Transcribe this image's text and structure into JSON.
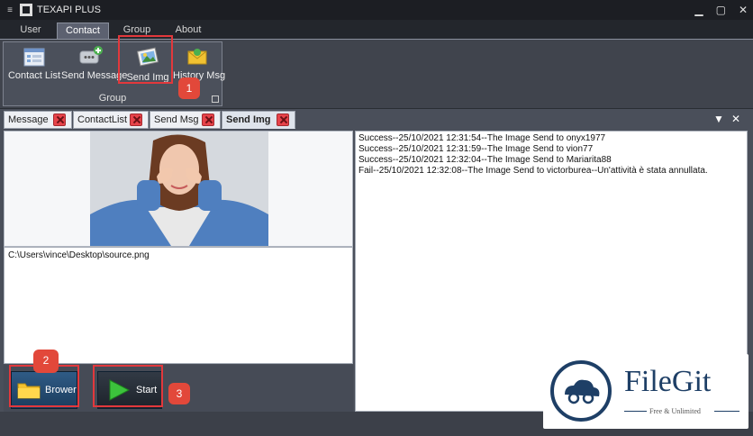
{
  "window": {
    "title": "TEXAPI PLUS",
    "sysmenu_glyph": "≡"
  },
  "menu": {
    "tabs": [
      "User",
      "Contact",
      "Group",
      "About"
    ],
    "active_index": 1
  },
  "ribbon": {
    "group_label": "Group",
    "buttons": [
      {
        "label": "Contact List",
        "icon": "contact-list-icon"
      },
      {
        "label": "Send Message",
        "icon": "send-message-icon"
      },
      {
        "label": "Send Img",
        "icon": "send-img-icon"
      },
      {
        "label": "History Msg",
        "icon": "history-msg-icon"
      }
    ]
  },
  "doc_tabs": {
    "tabs": [
      "Message",
      "ContactList",
      "Send Msg",
      "Send Img"
    ],
    "active_index": 3
  },
  "send_img": {
    "file_path": "C:\\Users\\vince\\Desktop\\source.png",
    "browse_label": "Brower",
    "start_label": "Start"
  },
  "log": [
    "Success--25/10/2021 12:31:54--The Image Send to onyx1977",
    "Success--25/10/2021 12:31:59--The Image Send to vion77",
    "Success--25/10/2021 12:32:04--The Image Send to Mariarita88",
    "Fail--25/10/2021 12:32:08--The Image Send to victorburea--Un'attività è stata annullata."
  ],
  "annotations": [
    "1",
    "2",
    "3"
  ],
  "watermark": {
    "title": "FileGit",
    "subtitle": "Free & Unlimited"
  },
  "colors": {
    "highlight": "#e2383c",
    "badge": "#e2483a",
    "brand": "#1e3f66"
  }
}
